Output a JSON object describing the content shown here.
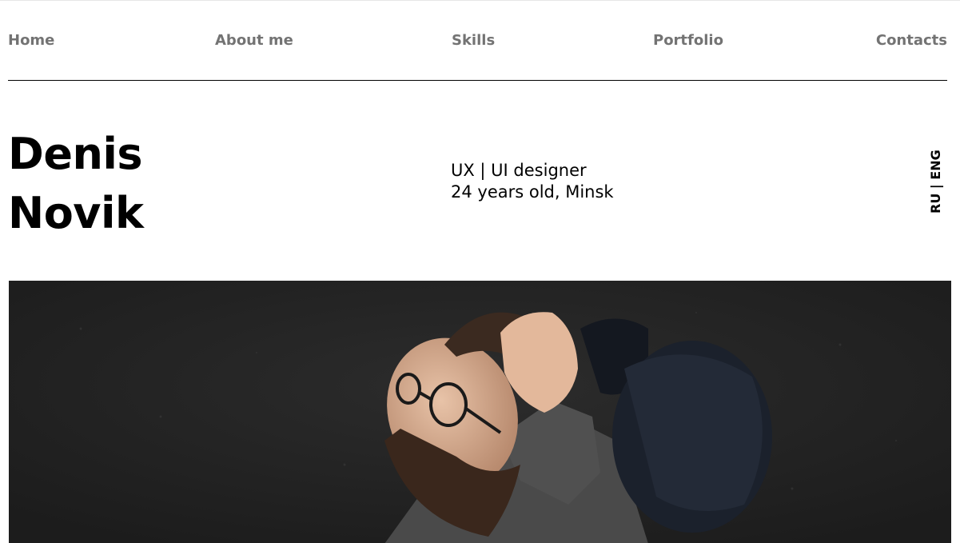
{
  "nav": {
    "items": [
      {
        "label": "Home"
      },
      {
        "label": "About me"
      },
      {
        "label": "Skills"
      },
      {
        "label": "Portfolio"
      },
      {
        "label": "Contacts"
      }
    ]
  },
  "hero": {
    "first_name": "Denis",
    "last_name": "Novik",
    "role": "UX | UI designer",
    "info": "24 years old, Minsk"
  },
  "language": {
    "ru": "RU",
    "separator": " | ",
    "eng": "ENG"
  },
  "photo": {
    "subject": "man with glasses and beard holding a dark cap against a dark wall"
  },
  "colors": {
    "nav_text": "#737373",
    "text": "#000000",
    "background": "#ffffff",
    "photo_bg": "#232323"
  }
}
